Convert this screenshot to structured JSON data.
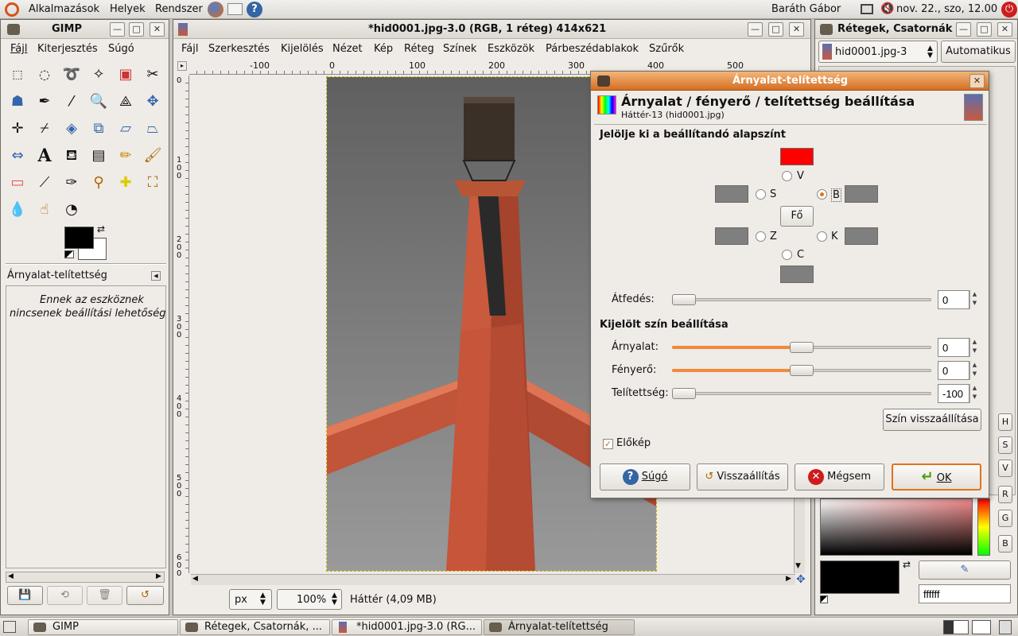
{
  "top_panel": {
    "menus": [
      "Alkalmazások",
      "Helyek",
      "Rendszer"
    ],
    "user": "Baráth Gábor",
    "clock": "nov. 22., szo, 12.00"
  },
  "toolbox": {
    "title": "GIMP",
    "menu": [
      "Fájl",
      "Kiterjesztés",
      "Súgó"
    ],
    "tool_options_title": "Árnyalat-telítettség",
    "tool_options_text_1": "Ennek az eszköznek",
    "tool_options_text_2": "nincsenek beállítási lehetőségei"
  },
  "image_window": {
    "title": "*hid0001.jpg-3.0 (RGB, 1 réteg) 414x621",
    "menu": [
      "Fájl",
      "Szerkesztés",
      "Kijelölés",
      "Nézet",
      "Kép",
      "Réteg",
      "Színek",
      "Eszközök",
      "Párbeszédablakok",
      "Szűrők"
    ],
    "ruler_labels": [
      "-100",
      "0",
      "100",
      "200",
      "300",
      "400",
      "500"
    ],
    "vruler_labels": [
      "0",
      "1\n0\n0",
      "2\n0\n0",
      "3\n0\n0",
      "4\n0\n0",
      "5\n0\n0",
      "6\n0\n0"
    ],
    "unit": "px",
    "zoom": "100%",
    "status": "Háttér (4,09 MB)"
  },
  "layers_window": {
    "title": "Rétegek, Csatornák, ...",
    "image_select": "hid0001.jpg-3",
    "auto_button": "Automatikus",
    "hex_value": "ffffff",
    "channel_buttons": [
      "H",
      "S",
      "V",
      "R",
      "G",
      "B"
    ]
  },
  "dialog": {
    "title": "Árnyalat-telítettség",
    "heading": "Árnyalat / fényerő / telítettség beállítása",
    "subheading": "Háttér-13 (hid0001.jpg)",
    "section1": "Jelölje ki a beállítandó alapszínt",
    "radio_labels": {
      "Y": "V",
      "S": "S",
      "B": "B",
      "Z": "Z",
      "K": "K",
      "C": "C"
    },
    "master_button": "Fő",
    "overlap_label": "Átfedés:",
    "overlap_value": "0",
    "section2": "Kijelölt szín beállítása",
    "hue_label": "Árnyalat:",
    "hue_value": "0",
    "lightness_label": "Fényerő:",
    "lightness_value": "0",
    "saturation_label": "Telítettség:",
    "saturation_value": "-100",
    "reset_color_button": "Szín visszaállítása",
    "preview_label": "Előkép",
    "preview_checked": true,
    "buttons": {
      "help": "Súgó",
      "reset": "Visszaállítás",
      "cancel": "Mégsem",
      "ok": "OK"
    },
    "colors": {
      "selected_swatch": "#ff0000",
      "gray_swatch": "#7f7f7f",
      "accent": "#f08a3c"
    }
  },
  "taskbar": {
    "tasks": [
      "GIMP",
      "Rétegek, Csatornák, ...",
      "*hid0001.jpg-3.0 (RG...",
      "Árnyalat-telítettség"
    ]
  }
}
